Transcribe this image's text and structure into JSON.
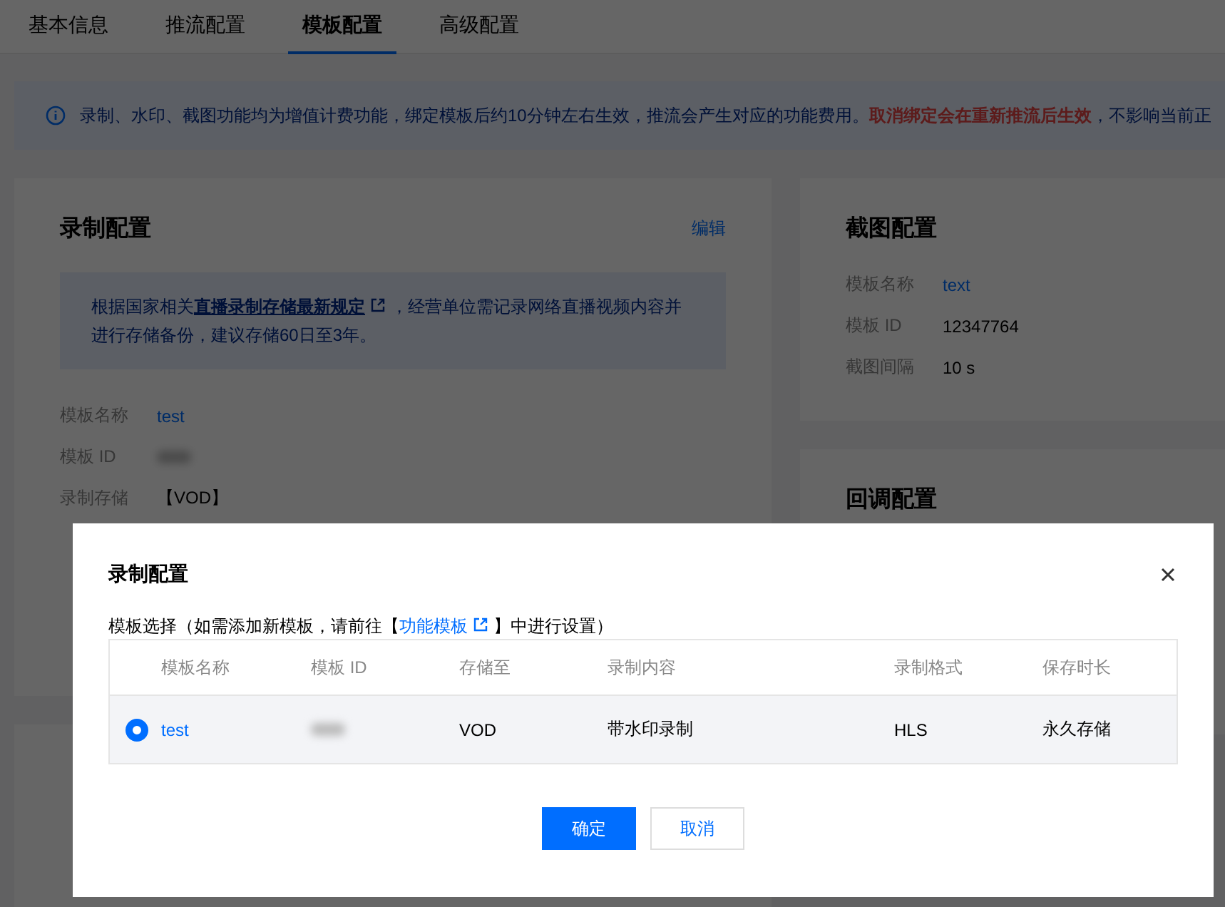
{
  "tabs": [
    {
      "label": "基本信息",
      "selected": false
    },
    {
      "label": "推流配置",
      "selected": false
    },
    {
      "label": "模板配置",
      "selected": true
    },
    {
      "label": "高级配置",
      "selected": false
    }
  ],
  "notice": {
    "text": "录制、水印、截图功能均为增值计费功能，绑定模板后约10分钟左右生效，推流会产生对应的功能费用。**取消绑定会在重新推流后生效**，不影响当前正"
  },
  "record_card": {
    "title": "录制配置",
    "edit_link": "编辑",
    "notice": {
      "before": "根据国家相关",
      "link": "直播录制存储最新规定",
      "after": "，经营单位需记录网络直播视频内容并进行存储备份，建议存储60日至3年。"
    },
    "fields": [
      {
        "label": "模板名称",
        "value": "test",
        "kind": "link"
      },
      {
        "label": "模板 ID",
        "kind": "redacted"
      },
      {
        "label": "录制存储",
        "value": "【VOD】",
        "kind": "text"
      }
    ]
  },
  "screenshot_card": {
    "title": "截图配置",
    "fields": [
      {
        "label": "模板名称",
        "value": "text",
        "kind": "link"
      },
      {
        "label": "模板 ID",
        "value": "12347764",
        "kind": "text"
      },
      {
        "label": "截图间隔",
        "value": "10 s",
        "kind": "text"
      }
    ]
  },
  "callback_card": {
    "title": "回调配置"
  },
  "dialog": {
    "title": "录制配置",
    "hint": {
      "before": "模板选择（如需添加新模板，请前往【",
      "link": "功能模板",
      "after": "】中进行设置）"
    },
    "columns": [
      "模板名称",
      "模板 ID",
      "存储至",
      "录制内容",
      "录制格式",
      "保存时长"
    ],
    "rows": [
      {
        "selected": true,
        "name": "test",
        "storage": "VOD",
        "content": "带水印录制",
        "format": "HLS",
        "duration": "永久存储"
      }
    ],
    "buttons": [
      {
        "label": "确定",
        "kind": "primary"
      },
      {
        "label": "取消",
        "kind": "secondary"
      }
    ]
  }
}
